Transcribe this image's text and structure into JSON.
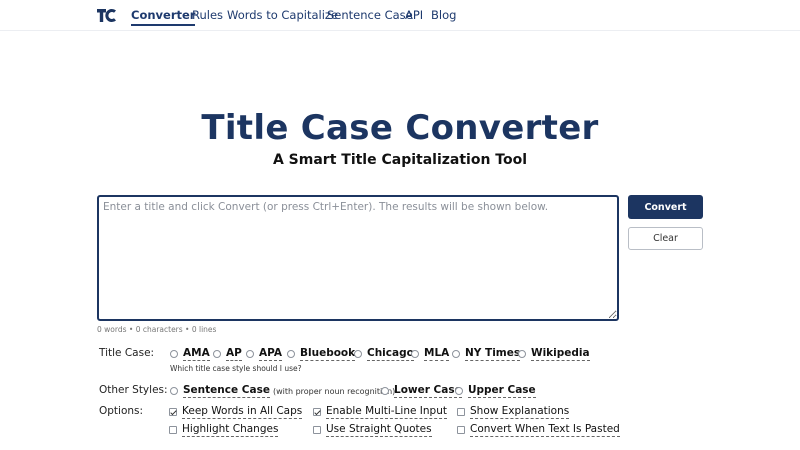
{
  "nav": {
    "logo_icon": "tc-logo-icon",
    "links": [
      "Converter",
      "Rules",
      "Words to Capitalize",
      "Sentence Case",
      "API",
      "Blog"
    ]
  },
  "header": {
    "title": "Title Case Converter",
    "subtitle": "A Smart Title Capitalization Tool"
  },
  "editor": {
    "placeholder": "Enter a title and click Convert (or press Ctrl+Enter). The results will be shown below.",
    "value": "",
    "counter": "0 words • 0 characters • 0 lines"
  },
  "buttons": {
    "convert": "Convert",
    "clear": "Clear"
  },
  "title_case": {
    "label": "Title Case:",
    "options": [
      "AMA",
      "AP",
      "APA",
      "Bluebook",
      "Chicago",
      "MLA",
      "NY Times",
      "Wikipedia"
    ],
    "help": "Which title case style should I use?"
  },
  "other_styles": {
    "label": "Other Styles:",
    "sentence_case": "Sentence Case",
    "sentence_case_note": "(with proper noun recognition)",
    "lower_case": "Lower Case",
    "upper_case": "Upper Case"
  },
  "options": {
    "label": "Options:",
    "items": [
      {
        "label": "Keep Words in All Caps",
        "checked": true
      },
      {
        "label": "Enable Multi-Line Input",
        "checked": true
      },
      {
        "label": "Show Explanations",
        "checked": false
      },
      {
        "label": "Highlight Changes",
        "checked": false
      },
      {
        "label": "Use Straight Quotes",
        "checked": false
      },
      {
        "label": "Convert When Text Is Pasted",
        "checked": false
      }
    ]
  },
  "colors": {
    "brand": "#1c3561",
    "nav_text": "#1e3a6e"
  }
}
